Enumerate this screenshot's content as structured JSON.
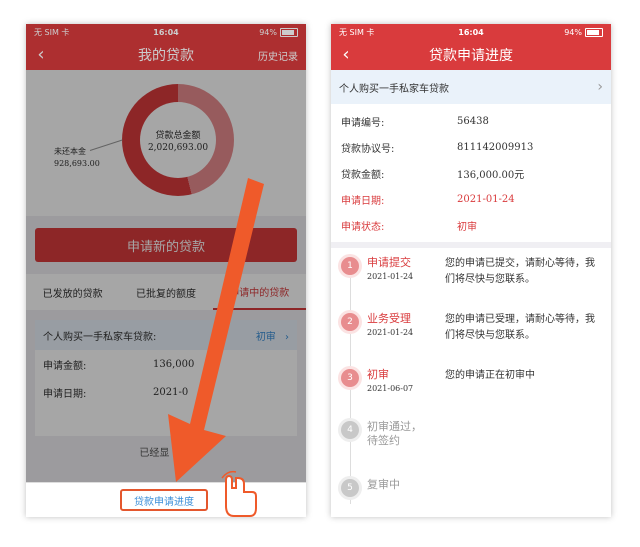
{
  "status_bar": {
    "carrier": "无 SIM 卡",
    "time": "16:04",
    "battery": "94%"
  },
  "left_screen": {
    "nav": {
      "back": "‹",
      "title": "我的贷款",
      "history_link": "历史记录"
    },
    "summary": {
      "total_label": "贷款总金额",
      "total_amount": "2,020,693.00",
      "unpaid_label": "未还本金",
      "unpaid_amount": "928,693.00",
      "unpaid_fraction": 0.46
    },
    "apply_button": "申请新的贷款",
    "tabs": [
      {
        "label": "已发放的贷款",
        "active": false
      },
      {
        "label": "已批复的额度",
        "active": false
      },
      {
        "label": "申请中的贷款",
        "active": true
      }
    ],
    "loan_card": {
      "title": "个人购买一手私家车贷款:",
      "status": "初审",
      "chevron": "›",
      "rows": [
        {
          "k": "申请金额:",
          "v": "136,000"
        },
        {
          "k": "申请日期:",
          "v": "2021-0"
        }
      ]
    },
    "shown_all": "已经显    记录",
    "progress_link": "贷款申请进度"
  },
  "right_screen": {
    "nav": {
      "back": "‹",
      "title": "贷款申请进度"
    },
    "loan_name": "个人购买一手私家车贷款",
    "chevron": "›",
    "details": [
      {
        "k": "申请编号:",
        "v": "56438",
        "red": false
      },
      {
        "k": "贷款协议号:",
        "v": "811142009913",
        "red": false
      },
      {
        "k": "贷款金额:",
        "v": "136,000.00元",
        "red": false
      },
      {
        "k": "申请日期:",
        "v": "2021-01-24",
        "red": true
      },
      {
        "k": "申请状态:",
        "v": "初审",
        "red": true
      }
    ],
    "steps": [
      {
        "num": "1",
        "name": "申请提交",
        "date": "2021-01-24",
        "desc": "您的申请已提交，请耐心等待，我们将尽快与您联系。",
        "done": true
      },
      {
        "num": "2",
        "name": "业务受理",
        "date": "2021-01-24",
        "desc": "您的申请已受理，请耐心等待，我们将尽快与您联系。",
        "done": true
      },
      {
        "num": "3",
        "name": "初审",
        "date": "2021-06-07",
        "desc": "您的申请正在初审中",
        "done": true
      },
      {
        "num": "4",
        "name": "初审通过，待签约",
        "date": "",
        "desc": "",
        "done": false
      },
      {
        "num": "5",
        "name": "复审中",
        "date": "",
        "desc": "",
        "done": false
      }
    ]
  },
  "colors": {
    "brand_red": "#d93b3d",
    "link_blue": "#3a8ed8",
    "arrow_orange": "#ef5a2a"
  }
}
